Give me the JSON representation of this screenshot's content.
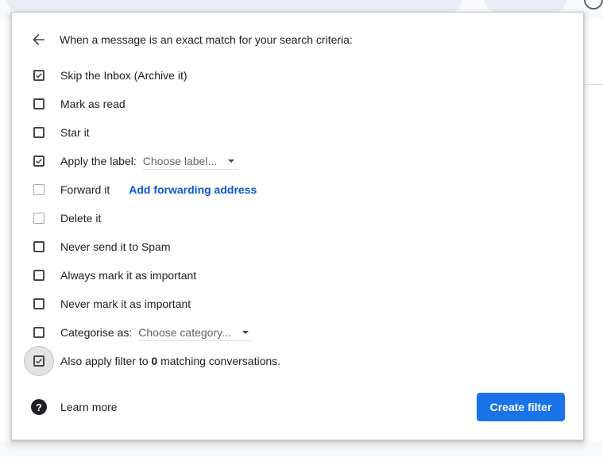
{
  "header": {
    "back_icon": "arrow-back-icon",
    "text": "When a message is an exact match for your search criteria:"
  },
  "options": [
    {
      "label": "Skip the Inbox (Archive it)",
      "checked": true
    },
    {
      "label": "Mark as read",
      "checked": false
    },
    {
      "label": "Star it",
      "checked": false
    },
    {
      "label": "Apply the label:",
      "checked": true,
      "select": "Choose label..."
    },
    {
      "label": "Forward it",
      "checked": false,
      "disabled": true,
      "link": "Add forwarding address"
    },
    {
      "label": "Delete it",
      "checked": false,
      "disabled": true
    },
    {
      "label": "Never send it to Spam",
      "checked": false
    },
    {
      "label": "Always mark it as important",
      "checked": false
    },
    {
      "label": "Never mark it as important",
      "checked": false
    },
    {
      "label": "Categorise as:",
      "checked": false,
      "select": "Choose category..."
    }
  ],
  "apply_filter": {
    "prefix": "Also apply filter to",
    "count": "0",
    "suffix": "matching conversations.",
    "checked": true,
    "focused": true
  },
  "footer": {
    "help_icon": "help-icon",
    "learn_more": "Learn more",
    "create_filter": "Create filter"
  },
  "colors": {
    "primary": "#1a73e8",
    "link": "#0b57d0"
  }
}
